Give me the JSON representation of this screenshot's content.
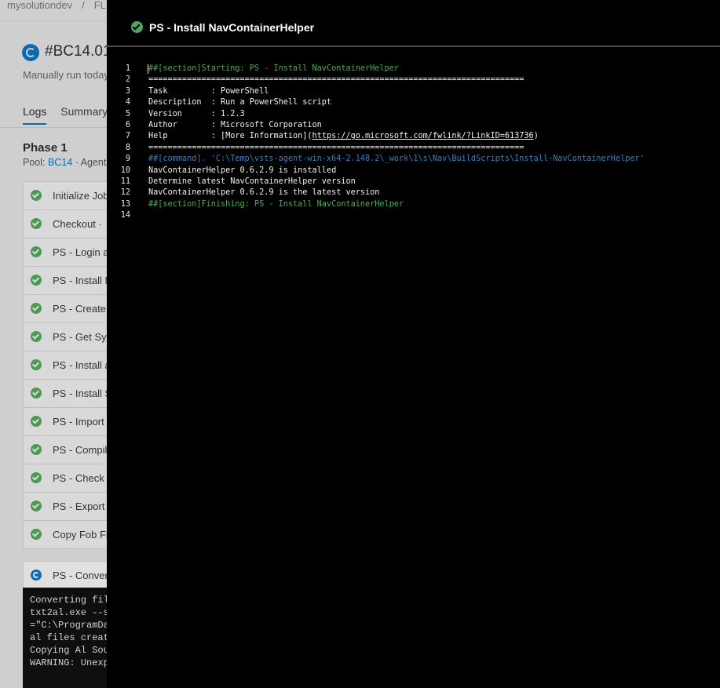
{
  "breadcrumb": {
    "org": "mysolutiondev",
    "project": "FL"
  },
  "run": {
    "title": "#BC14.01",
    "subtitle": "Manually run today"
  },
  "tabs": [
    {
      "label": "Logs"
    },
    {
      "label": "Summary"
    }
  ],
  "phase": {
    "title": "Phase 1",
    "pool_prefix": "Pool: ",
    "pool_link": "BC14",
    "pool_suffix": " · Agents"
  },
  "steps": [
    "Initialize Job",
    "Checkout  ·",
    "PS - Login ar",
    "PS - Install N",
    "PS - Create N",
    "PS - Get Syst",
    "PS - Install as",
    "PS - Install S",
    "PS - Import C",
    "PS - Compile",
    "PS - Check F",
    "PS - Export C",
    "Copy Fob File"
  ],
  "running_step": "PS - Convert",
  "console_lines": [
    "Converting fil",
    "txt2al.exe --s",
    "=\"C:\\ProgramDat",
    "al files create",
    "Copying Al Sou",
    "WARNING: Unexp"
  ],
  "panel": {
    "title": "PS - Install NavContainerHelper",
    "lines": [
      {
        "n": "1",
        "type": "section",
        "text": "##[section]Starting: PS - Install NavContainerHelper"
      },
      {
        "n": "2",
        "type": "plain",
        "text": "=============================================================================="
      },
      {
        "n": "3",
        "type": "plain",
        "text": "Task         : PowerShell"
      },
      {
        "n": "4",
        "type": "plain",
        "text": "Description  : Run a PowerShell script"
      },
      {
        "n": "5",
        "type": "plain",
        "text": "Version      : 1.2.3"
      },
      {
        "n": "6",
        "type": "plain",
        "text": "Author       : Microsoft Corporation"
      },
      {
        "n": "7",
        "type": "help",
        "text": "Help         : [More Information](",
        "url": "https://go.microsoft.com/fwlink/?LinkID=613736",
        "after": ")"
      },
      {
        "n": "8",
        "type": "plain",
        "text": "=============================================================================="
      },
      {
        "n": "9",
        "type": "command",
        "text": "##[command]. 'C:\\Temp\\vsts-agent-win-x64-2.148.2\\_work\\1\\s\\Nav\\BuildScripts\\Install-NavContainerHelper'"
      },
      {
        "n": "10",
        "type": "plain",
        "text": "NavContainerHelper 0.6.2.9 is installed"
      },
      {
        "n": "11",
        "type": "plain",
        "text": "Determine latest NavContainerHelper version"
      },
      {
        "n": "12",
        "type": "plain",
        "text": "NavContainerHelper 0.6.2.9 is the latest version"
      },
      {
        "n": "13",
        "type": "section",
        "text": "##[section]Finishing: PS - Install NavContainerHelper"
      },
      {
        "n": "14",
        "type": "plain",
        "text": ""
      }
    ]
  },
  "icons": {
    "status_success": "check-circle-icon",
    "status_running": "running-icon"
  },
  "colors": {
    "success": "#55a362",
    "section": "#4ab04c",
    "command": "#3b7fc4",
    "accent": "#0e6ab0"
  }
}
